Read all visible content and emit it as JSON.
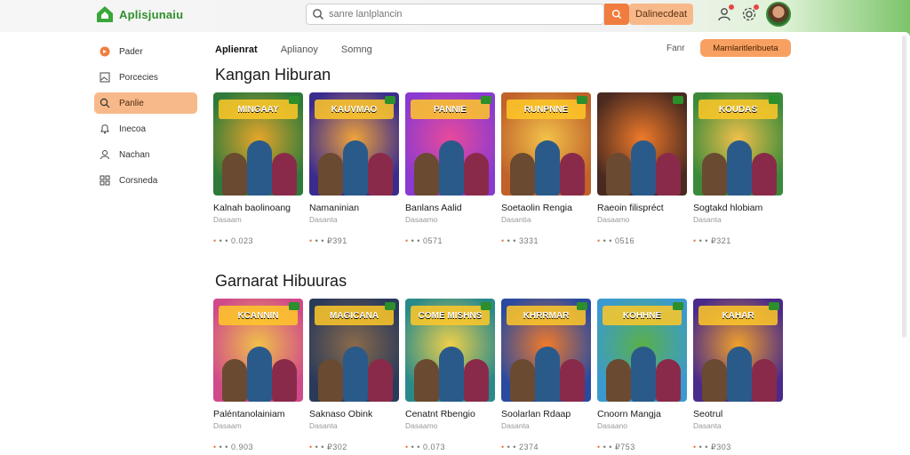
{
  "header": {
    "app_name": "Aplisjunaiu",
    "search_placeholder": "sanre lanlplancin",
    "cta_label": "Dalinecdeat"
  },
  "sidebar": {
    "items": [
      {
        "label": "Pader",
        "icon": "play-icon",
        "active": false
      },
      {
        "label": "Porcecies",
        "icon": "image-icon",
        "active": false
      },
      {
        "label": "Panlie",
        "icon": "search-icon",
        "active": true
      },
      {
        "label": "Inecoa",
        "icon": "bell-icon",
        "active": false
      },
      {
        "label": "Nachan",
        "icon": "user-icon",
        "active": false
      },
      {
        "label": "Corsneda",
        "icon": "grid-icon",
        "active": false
      }
    ]
  },
  "tabs": [
    {
      "label": "Aplienrat",
      "active": true
    },
    {
      "label": "Aplianoy",
      "active": false
    },
    {
      "label": "Somng",
      "active": false
    }
  ],
  "filter_label": "Fanr",
  "panel_cta_label": "Marnlaritleribueta",
  "sections": [
    {
      "title": "Kangan Hiburan",
      "cards": [
        {
          "thumb_title": "MINGAAY",
          "title": "Kalnah baolinoang",
          "subtitle": "Dasaam",
          "meta": "0.023",
          "colors": [
            "#2f7a3a",
            "#e7a52a"
          ]
        },
        {
          "thumb_title": "KAUVMAO",
          "title": "Namaninian",
          "subtitle": "Dasanta",
          "meta": "₽391",
          "colors": [
            "#3a2b8f",
            "#f0a33a"
          ]
        },
        {
          "thumb_title": "PANNIE",
          "title": "Banlans Aalid",
          "subtitle": "Dasaamo",
          "meta": "0571",
          "colors": [
            "#8a3ad0",
            "#e94a9a"
          ]
        },
        {
          "thumb_title": "RUNPNNE",
          "title": "Soetaolin Rengia",
          "subtitle": "Dasantia",
          "meta": "3331",
          "colors": [
            "#c0622a",
            "#f2c24a"
          ]
        },
        {
          "thumb_title": "",
          "title": "Raeoin filispréct",
          "subtitle": "Dasaamo",
          "meta": "0516",
          "colors": [
            "#4a2a20",
            "#f07a2a"
          ]
        },
        {
          "thumb_title": "KOUDAS",
          "title": "Sogtakd hlobiam",
          "subtitle": "Dasanta",
          "meta": "₽321",
          "colors": [
            "#3a8a3a",
            "#f0c04a"
          ]
        }
      ]
    },
    {
      "title": "Garnarat Hibuuras",
      "cards": [
        {
          "thumb_title": "KCANNIN",
          "title": "Paléntanolainiam",
          "subtitle": "Dasaam",
          "meta": "0.903",
          "colors": [
            "#d04a8a",
            "#f0c04a"
          ]
        },
        {
          "thumb_title": "MAGICANA",
          "title": "Saknaso Obink",
          "subtitle": "Dasanta",
          "meta": "₽302",
          "colors": [
            "#2a3a5a",
            "#8a6a4a"
          ]
        },
        {
          "thumb_title": "COME MISHNS",
          "title": "Cenatnt Rbengio",
          "subtitle": "Dasaamo",
          "meta": "0.073",
          "colors": [
            "#2a8a8a",
            "#f0d04a"
          ]
        },
        {
          "thumb_title": "KHRRMAR",
          "title": "Soolarlan Rdaap",
          "subtitle": "Dasanta",
          "meta": "2374",
          "colors": [
            "#2a4aa0",
            "#f07a2a"
          ]
        },
        {
          "thumb_title": "KOHHNE",
          "title": "Cnoorn Mangja",
          "subtitle": "Dasaano",
          "meta": "₽753",
          "colors": [
            "#3a9ad0",
            "#5ab04a"
          ]
        },
        {
          "thumb_title": "KAHAR",
          "title": "Seotrul",
          "subtitle": "Dasanta",
          "meta": "₽303",
          "colors": [
            "#4a2a8a",
            "#f0a02a"
          ]
        }
      ]
    }
  ]
}
